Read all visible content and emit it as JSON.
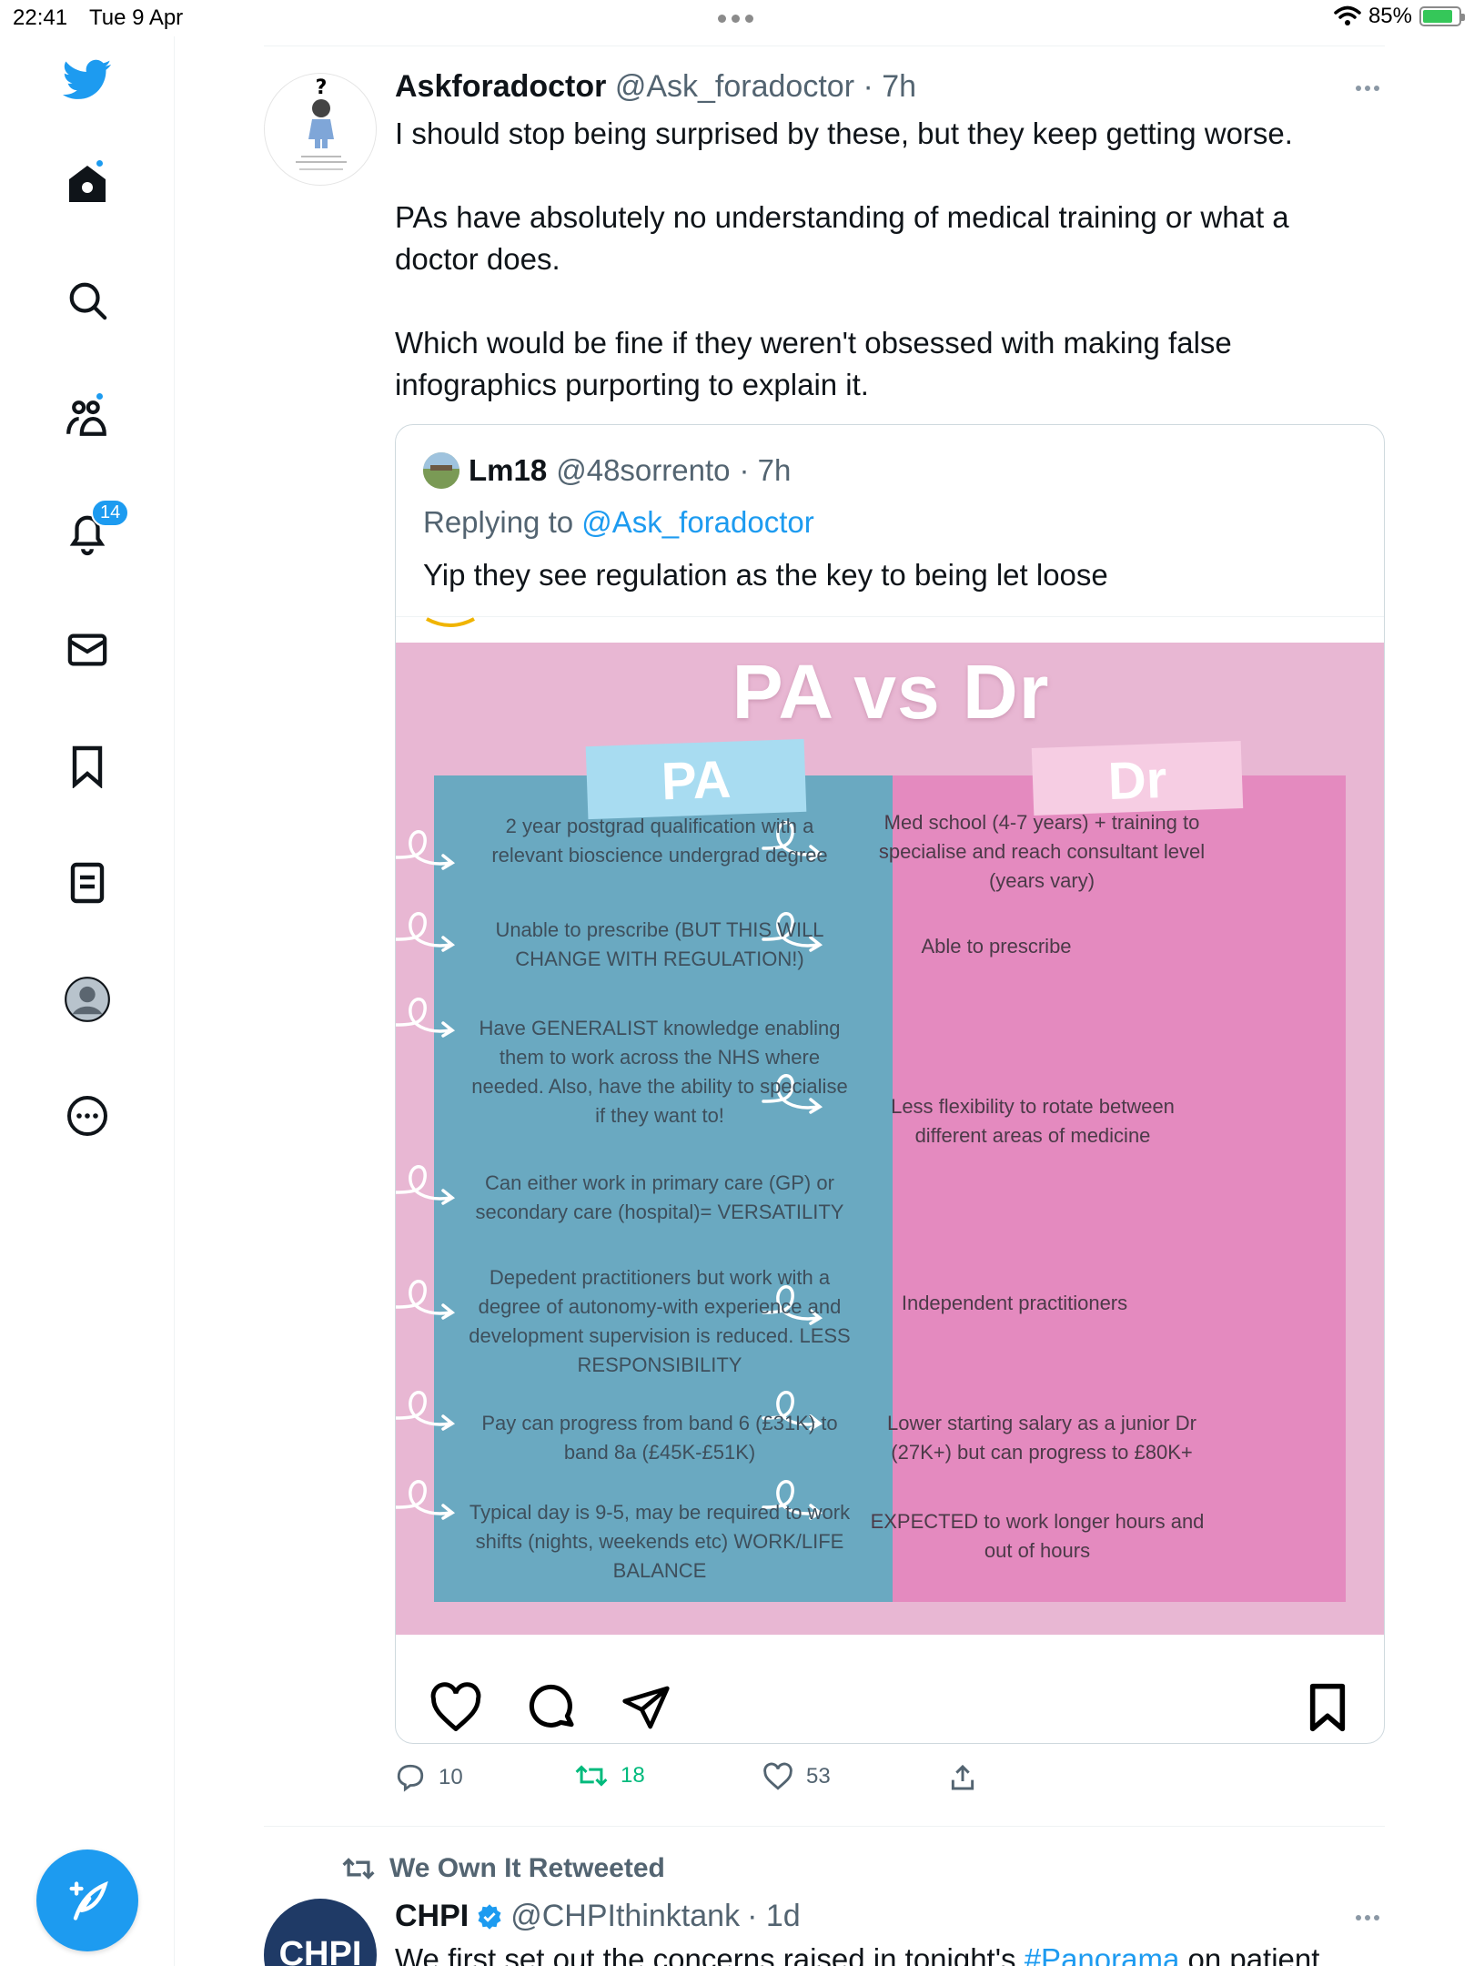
{
  "status_bar": {
    "time": "22:41",
    "date": "Tue 9 Apr",
    "battery": "85%"
  },
  "sidebar": {
    "items": [
      "twitter-logo",
      "home",
      "explore",
      "communities",
      "notifications",
      "messages",
      "bookmarks",
      "lists",
      "profile",
      "more"
    ],
    "notifications_count": "14"
  },
  "tweet": {
    "author_name": "Askforadoctor",
    "author_handle": "@Ask_foradoctor",
    "time": "· 7h",
    "paragraphs": [
      "I should stop being surprised by these, but they keep getting worse.",
      "PAs have absolutely no understanding of medical training or what a doctor does.",
      "Which would be fine if they weren't obsessed with making false infographics purporting to explain it."
    ],
    "quote": {
      "author_name": "Lm18",
      "author_handle": "@48sorrento",
      "time": "· 7h",
      "replying_prefix": "Replying to",
      "replying_handle": "@Ask_foradoctor",
      "text": "Yip they see regulation as the key to being let loose",
      "infographic": {
        "title": "PA vs Dr",
        "pa_label": "PA",
        "dr_label": "Dr",
        "pa_items": [
          "2 year postgrad qualification with a relevant bioscience undergrad degree",
          "Unable to prescribe (BUT THIS WILL CHANGE WITH REGULATION!)",
          "Have GENERALIST knowledge enabling them to work across the NHS where needed. Also, have the ability to specialise if they want to!",
          "Can either work in primary care (GP) or secondary care (hospital)= VERSATILITY",
          "Depedent practitioners but work with a degree of autonomy-with experience and development supervision is reduced. LESS RESPONSIBILITY",
          "Pay can progress from band 6 (£31K) to band 8a (£45K-£51K)",
          "Typical day is 9-5, may be required to work shifts (nights, weekends etc) WORK/LIFE BALANCE"
        ],
        "dr_items": [
          "Med school (4-7 years) + training to specialise and reach consultant level (years vary)",
          "Able to prescribe",
          "Less flexibility to rotate between different areas of medicine",
          "Independent practitioners",
          "Lower starting salary as a junior Dr (27K+) but can progress to £80K+",
          "EXPECTED to work longer hours and out of hours"
        ]
      }
    },
    "actions": {
      "replies": "10",
      "retweets": "18",
      "likes": "53"
    }
  },
  "retweet_line": "We Own It Retweeted",
  "tweet2": {
    "author_name": "CHPI",
    "author_handle": "@CHPIthinktank",
    "time": "· 1d",
    "avatar_text": "CHPI",
    "text_before": "We first set out the concerns raised in tonight's ",
    "hashtag": "#Panorama",
    "text_after": " on patient"
  },
  "colors": {
    "accent": "#1d9bf0",
    "retweet": "#00ba7c",
    "pa_column": "#6aa9c1",
    "dr_column": "#e48abf",
    "infographic_bg": "#e8b7d3"
  }
}
